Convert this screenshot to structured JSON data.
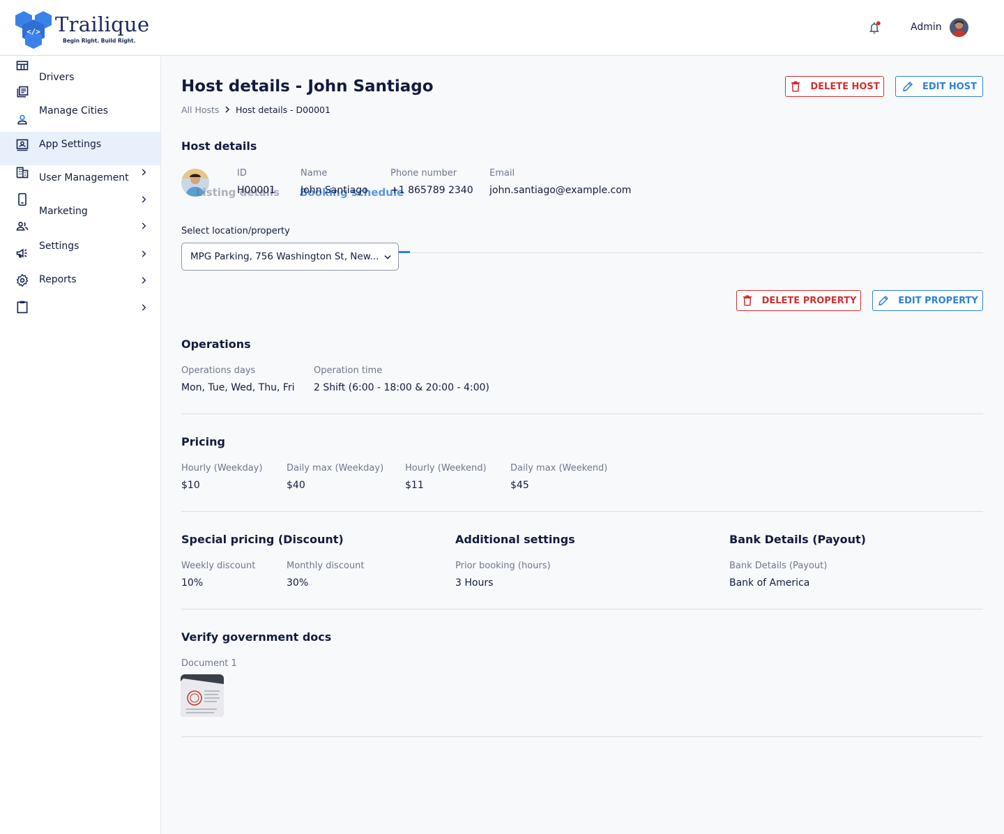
{
  "brand": {
    "name": "Trailique",
    "tagline": "Begin Right. Build Right.",
    "primary_color": "#2f7fd8",
    "danger_color": "#d32f2f"
  },
  "header": {
    "user_name": "Admin",
    "notification_icon": "bell-icon",
    "has_notification": true
  },
  "sidebar": {
    "items": [
      {
        "label": "",
        "icon": "dashboard-icon",
        "has_chevron": false
      },
      {
        "label": "Drivers",
        "icon": "list-icon",
        "has_chevron": false
      },
      {
        "label": "Manage Cities",
        "icon": "person-icon",
        "has_chevron": false
      },
      {
        "label": "App Settings",
        "icon": "app-settings-icon",
        "has_chevron": false,
        "active": true
      },
      {
        "label": "User Management",
        "icon": "building-icon",
        "has_chevron": true
      },
      {
        "label": "Marketing",
        "icon": "phone-icon",
        "has_chevron": true
      },
      {
        "label": "Settings",
        "icon": "group-icon",
        "has_chevron": true
      },
      {
        "label": "Reports",
        "icon": "megaphone-icon",
        "has_chevron": true
      },
      {
        "label": "",
        "icon": "gear-icon",
        "has_chevron": true
      },
      {
        "label": "",
        "icon": "clipboard-icon",
        "has_chevron": true
      }
    ]
  },
  "page": {
    "title": "Host details - John Santiago",
    "breadcrumb": {
      "parent": "All Hosts",
      "current": "Host details - D00001"
    },
    "delete_host_label": "DELETE HOST",
    "edit_host_label": "EDIT HOST"
  },
  "host": {
    "section_title": "Host details",
    "fields": [
      {
        "label": "ID",
        "value": "H00001"
      },
      {
        "label": "Name",
        "value": "John Santiago"
      },
      {
        "label": "Phone number",
        "value": "+1  865789 2340"
      },
      {
        "label": "Email",
        "value": "john.santiago@example.com"
      }
    ]
  },
  "tabs": {
    "listing_details": "Listing details",
    "booking_schedule": "Booking schedule"
  },
  "property": {
    "select_label": "Select location/property",
    "selected_value": "MPG Parking, 756 Washington St, New...",
    "delete_label": "DELETE PROPERTY",
    "edit_label": "EDIT PROPERTY"
  },
  "operations": {
    "title": "Operations",
    "days_label": "Operations days",
    "days_value": "Mon, Tue, Wed, Thu, Fri",
    "time_label": "Operation time",
    "time_value": "2 Shift (6:00 - 18:00 & 20:00 - 4:00)"
  },
  "pricing": {
    "title": "Pricing",
    "fields": [
      {
        "label": "Hourly (Weekday)",
        "value": "$10"
      },
      {
        "label": "Daily max (Weekday)",
        "value": "$40"
      },
      {
        "label": "Hourly (Weekend)",
        "value": "$11"
      },
      {
        "label": "Daily max (Weekend)",
        "value": "$45"
      }
    ]
  },
  "special_pricing": {
    "title": "Special pricing (Discount)",
    "weekly_label": "Weekly discount",
    "weekly_value": "10%",
    "monthly_label": "Monthly discount",
    "monthly_value": "30%"
  },
  "additional": {
    "title": "Additional settings",
    "label": "Prior booking (hours)",
    "value": "3 Hours"
  },
  "bank": {
    "title": "Bank Details (Payout)",
    "label": "Bank Details (Payout)",
    "value": "Bank of America"
  },
  "documents": {
    "title": "Verify government docs",
    "items": [
      {
        "label": "Document 1"
      }
    ]
  }
}
